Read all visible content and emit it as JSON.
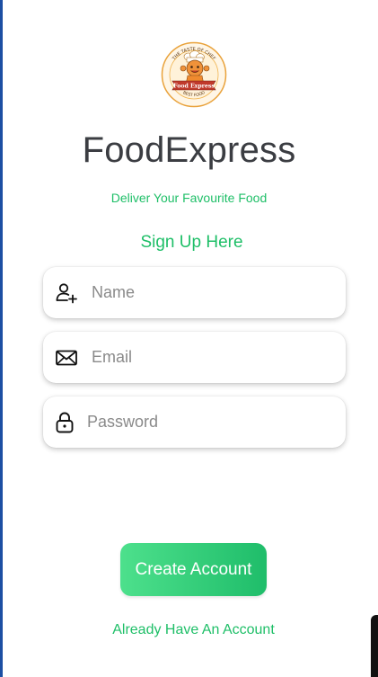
{
  "logo": {
    "arc_text_top": "THE TASTE OF CHEF",
    "arc_text_bottom": "BEST FOOD",
    "banner_text": "Food Express"
  },
  "app": {
    "title": "FoodExpress",
    "tagline": "Deliver Your Favourite Food"
  },
  "form": {
    "heading": "Sign Up Here",
    "name_placeholder": "Name",
    "email_placeholder": "Email",
    "password_placeholder": "Password"
  },
  "actions": {
    "create_account_label": "Create Account",
    "login_link_label": "Already Have An Account"
  },
  "colors": {
    "accent_green": "#1fbf68",
    "title_gray": "#3b3d42"
  },
  "icons": {
    "name": "add-user-icon",
    "email": "envelope-icon",
    "password": "lock-icon"
  }
}
